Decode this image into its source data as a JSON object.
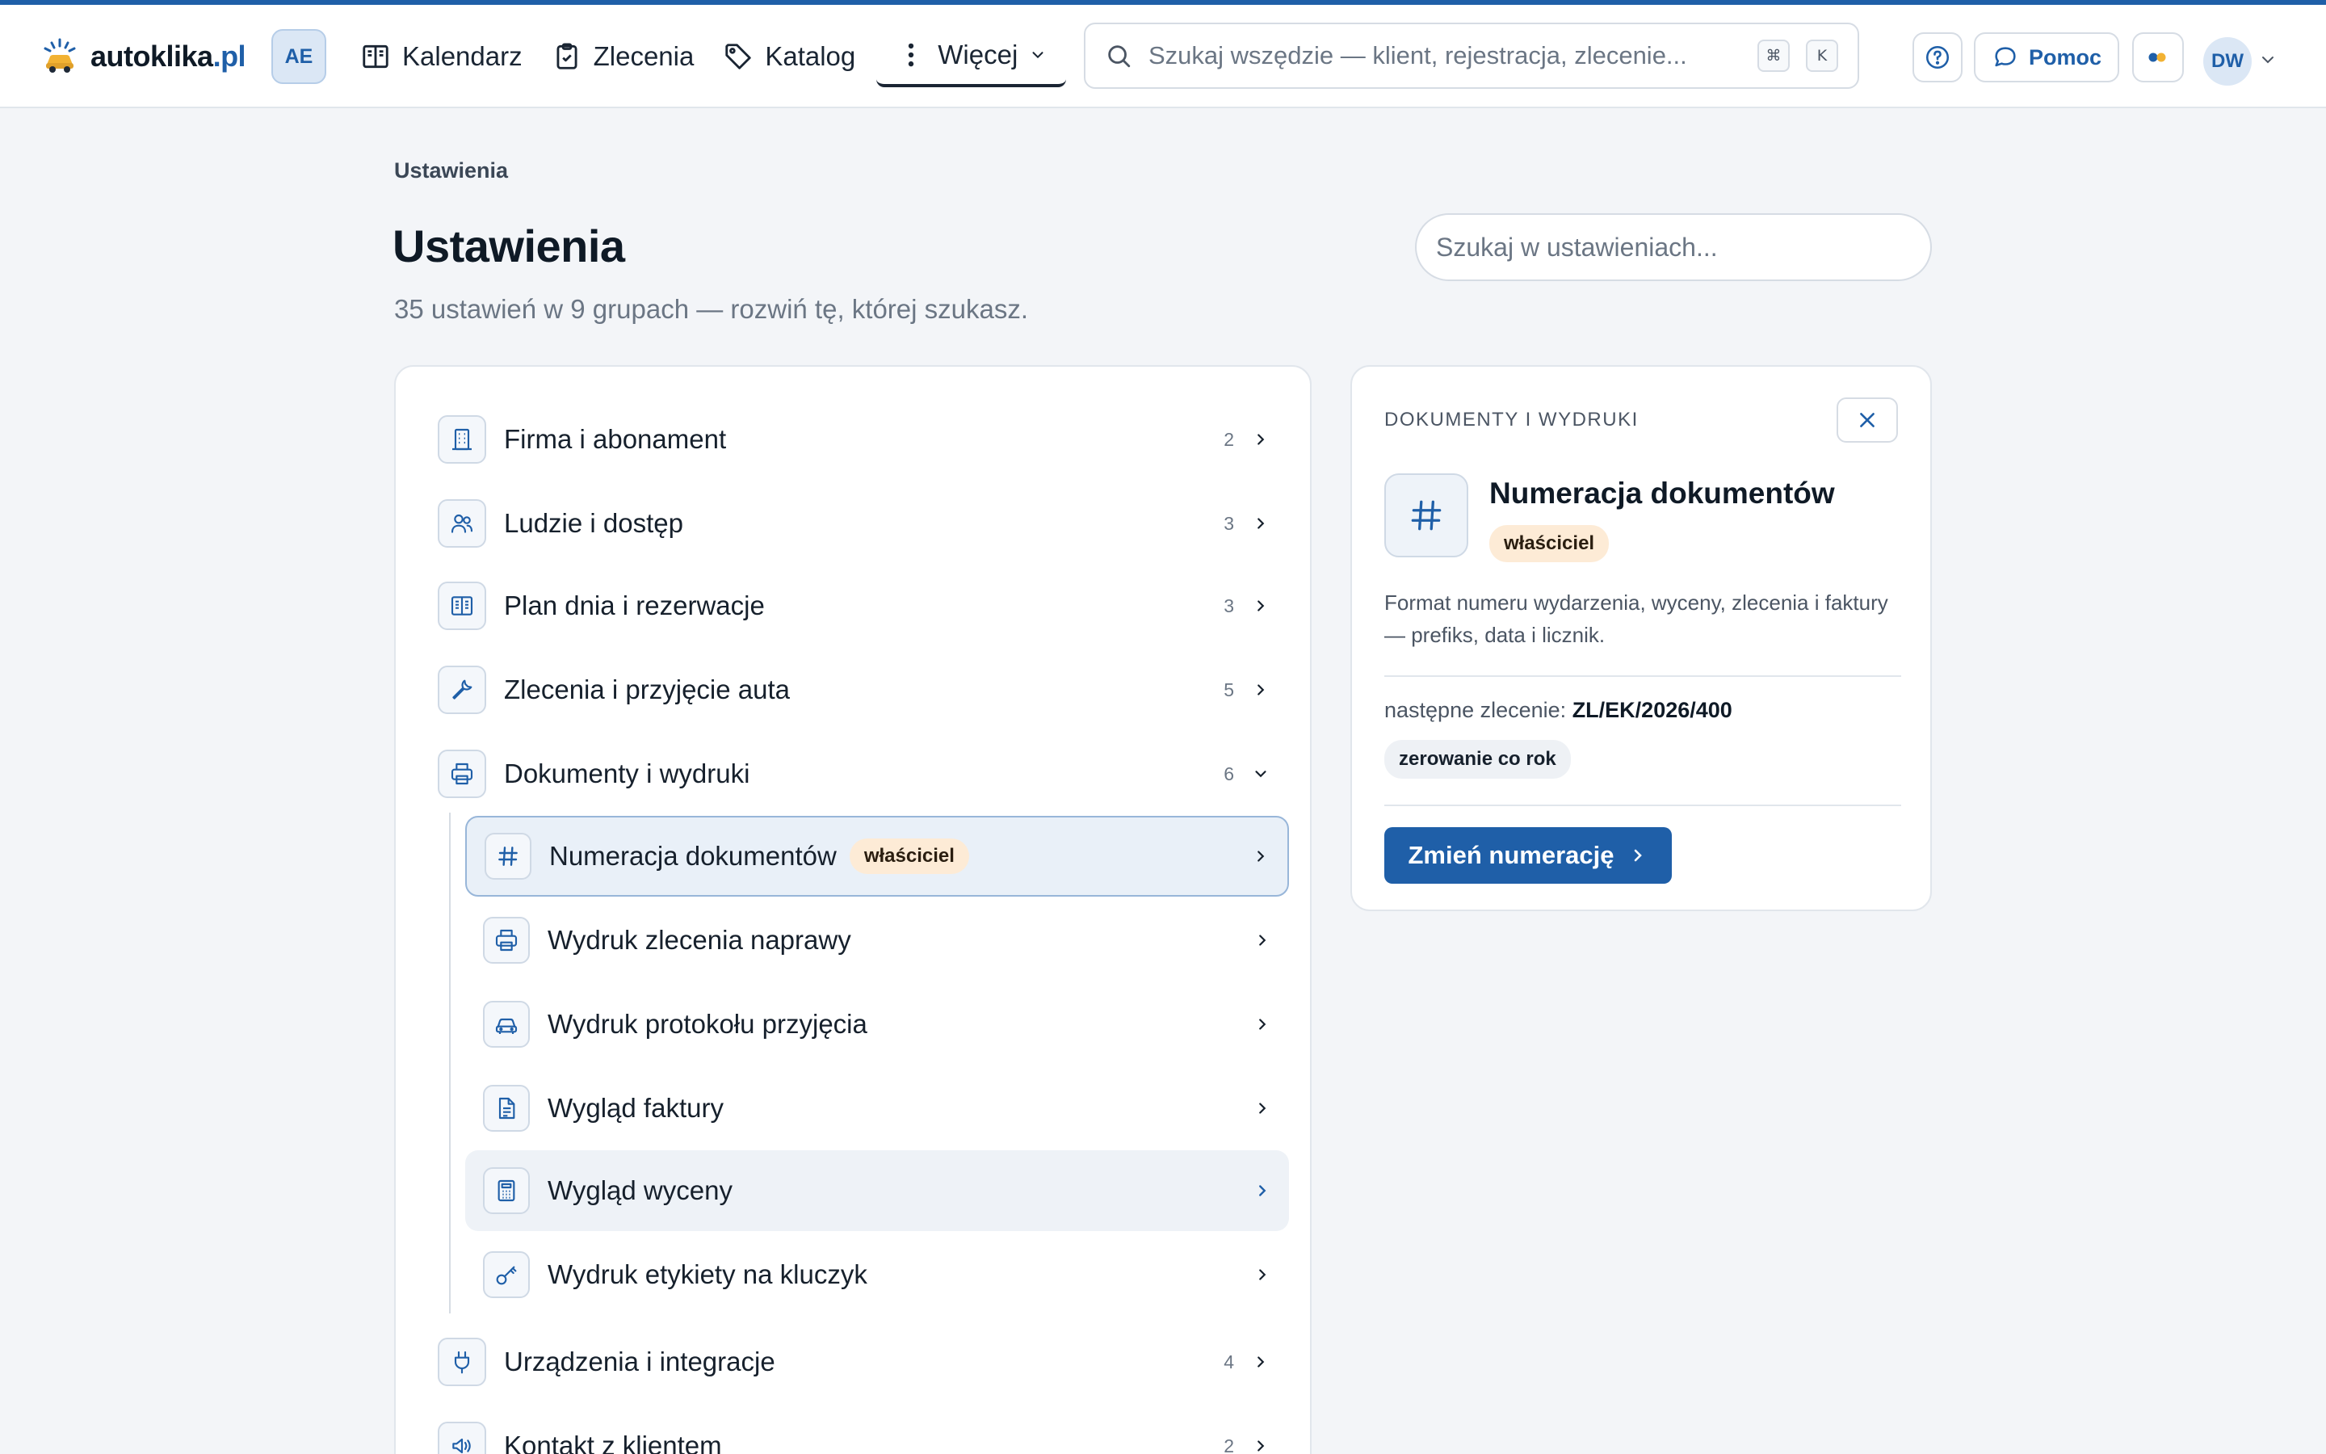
{
  "app": {
    "logo_name": "autoklika",
    "logo_tld": ".pl",
    "workspace": "AE",
    "accent": "#1f5fa8"
  },
  "nav": [
    {
      "label": "Kalendarz",
      "icon": "calendar-book-icon"
    },
    {
      "label": "Zlecenia",
      "icon": "clipboard-icon"
    },
    {
      "label": "Katalog",
      "icon": "tag-icon"
    },
    {
      "label": "Więcej",
      "icon": "more-vertical-icon",
      "active": true
    }
  ],
  "search": {
    "placeholder": "Szukaj wszędzie — klient, rejestracja, zlecenie...",
    "shortcut": [
      "⌘",
      "K"
    ]
  },
  "topbar": {
    "help_label": "Pomoc",
    "user_initials": "DW"
  },
  "page": {
    "breadcrumb": "Ustawienia",
    "title": "Ustawienia",
    "subtitle": "35 ustawień w 9 grupach — rozwiń tę, której szukasz.",
    "search_placeholder": "Szukaj w ustawieniach..."
  },
  "groups": [
    {
      "label": "Firma i abonament",
      "count": "2",
      "icon": "building-icon"
    },
    {
      "label": "Ludzie i dostęp",
      "count": "3",
      "icon": "users-icon"
    },
    {
      "label": "Plan dnia i rezerwacje",
      "count": "3",
      "icon": "columns-icon"
    },
    {
      "label": "Zlecenia i przyjęcie auta",
      "count": "5",
      "icon": "wrench-icon"
    },
    {
      "label": "Dokumenty i wydruki",
      "count": "6",
      "icon": "printer-icon",
      "expanded": true
    },
    {
      "label": "Urządzenia i integracje",
      "count": "4",
      "icon": "plug-icon"
    },
    {
      "label": "Kontakt z klientem",
      "count": "2",
      "icon": "megaphone-icon"
    }
  ],
  "subitems": [
    {
      "label": "Numeracja dokumentów",
      "badge": "właściciel",
      "icon": "hash-icon",
      "state": "selected"
    },
    {
      "label": "Wydruk zlecenia naprawy",
      "icon": "printer-icon"
    },
    {
      "label": "Wydruk protokołu przyjęcia",
      "icon": "car-icon"
    },
    {
      "label": "Wygląd faktury",
      "icon": "document-icon"
    },
    {
      "label": "Wygląd wyceny",
      "icon": "calculator-icon",
      "state": "hover"
    },
    {
      "label": "Wydruk etykiety na kluczyk",
      "icon": "key-icon"
    }
  ],
  "detail": {
    "overline": "DOKUMENTY I WYDRUKI",
    "title": "Numeracja dokumentów",
    "badge": "właściciel",
    "description": "Format numeru wydarzenia, wyceny, zlecenia i faktury — prefiks, data i licznik.",
    "next_label": "następne zlecenie:",
    "next_value": "ZL/EK/2026/400",
    "reset_tag": "zerowanie co rok",
    "button_label": "Zmień numerację"
  }
}
